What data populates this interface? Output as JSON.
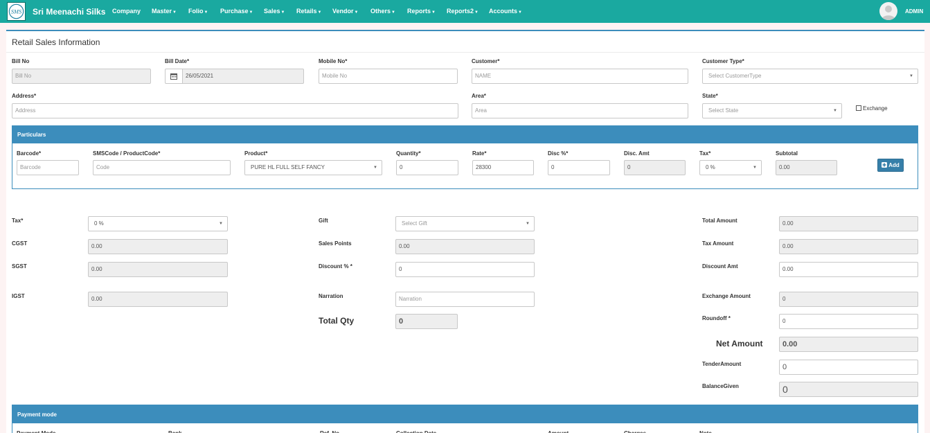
{
  "brand": {
    "name": "Sri Meenachi Silks",
    "logo_text": "SMS"
  },
  "nav": {
    "items": [
      "Company",
      "Master",
      "Folio",
      "Purchase",
      "Sales",
      "Retails",
      "Vendor",
      "Others",
      "Reports",
      "Reports2",
      "Accounts"
    ],
    "dropdown": [
      false,
      true,
      true,
      true,
      true,
      true,
      true,
      true,
      true,
      true,
      true
    ]
  },
  "user": {
    "name": "ADMIN"
  },
  "page": {
    "title": "Retail Sales Information"
  },
  "header_form": {
    "bill_no": {
      "label": "Bill No",
      "placeholder": "Bill No"
    },
    "bill_date": {
      "label": "Bill Date*",
      "value": "26/05/2021"
    },
    "mobile_no": {
      "label": "Mobile No*",
      "placeholder": "Mobile No"
    },
    "customer": {
      "label": "Customer*",
      "placeholder": "NAME"
    },
    "customer_type": {
      "label": "Customer Type*",
      "value": "Select CustomerType"
    },
    "address": {
      "label": "Address*",
      "placeholder": "Address"
    },
    "area": {
      "label": "Area*",
      "placeholder": "Area"
    },
    "state": {
      "label": "State*",
      "value": "Select State"
    },
    "exchange": {
      "label": "Exchange",
      "checked": false
    }
  },
  "particulars": {
    "title": "Particulars",
    "barcode": {
      "label": "Barcode*",
      "placeholder": "Barcode"
    },
    "code": {
      "label": "SMSCode / ProductCode*",
      "placeholder": "Code"
    },
    "product": {
      "label": "Product*",
      "value": "PURE HL FULL SELF FANCY"
    },
    "quantity": {
      "label": "Quantity*",
      "value": "0"
    },
    "rate": {
      "label": "Rate*",
      "value": "28300"
    },
    "disc_pct": {
      "label": "Disc %*",
      "value": "0"
    },
    "disc_amt": {
      "label": "Disc. Amt",
      "value": "0"
    },
    "tax": {
      "label": "Tax*",
      "value": "0 %"
    },
    "subtotal": {
      "label": "Subtotal",
      "value": "0.00"
    },
    "add_label": "Add"
  },
  "summary": {
    "tax": {
      "label": "Tax*",
      "value": "0 %"
    },
    "cgst": {
      "label": "CGST",
      "value": "0.00"
    },
    "sgst": {
      "label": "SGST",
      "value": "0.00"
    },
    "igst": {
      "label": "IGST",
      "value": "0.00"
    },
    "gift": {
      "label": "Gift",
      "value": "Select Gift"
    },
    "sales_points": {
      "label": "Sales Points",
      "value": "0.00"
    },
    "discount_pct": {
      "label": "Discount % *",
      "value": "0"
    },
    "narration": {
      "label": "Narration",
      "placeholder": "Narration"
    },
    "total_qty": {
      "label": "Total Qty",
      "value": "0"
    },
    "total_amount": {
      "label": "Total Amount",
      "value": "0.00"
    },
    "tax_amount": {
      "label": "Tax Amount",
      "value": "0.00"
    },
    "discount_amt": {
      "label": "Discount Amt",
      "value": "0.00"
    },
    "exchange_amount": {
      "label": "Exchange Amount",
      "value": "0"
    },
    "roundoff": {
      "label": "Roundoff *",
      "value": "0"
    },
    "net_amount": {
      "label": "Net Amount",
      "value": "0.00"
    },
    "tender_amount": {
      "label": "TenderAmount",
      "value": "0"
    },
    "balance_given": {
      "label": "BalanceGiven",
      "value": "0"
    }
  },
  "payment": {
    "title": "Payment mode",
    "columns": [
      "Payment Mode",
      "Bank",
      "Ref. No",
      "Collection Date",
      "Amount",
      "Charges",
      "Note"
    ]
  },
  "colors": {
    "topbar": "#1aa9a0",
    "panel_header": "#3c8dbc",
    "button": "#367fa9"
  }
}
